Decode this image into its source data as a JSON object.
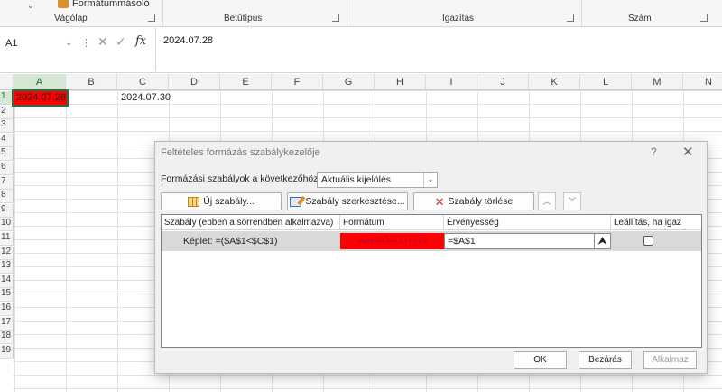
{
  "ribbon": {
    "clipboard_item": "Formátummásoló",
    "groups": [
      "Vágólap",
      "Betűtípus",
      "Igazítás",
      "Szám"
    ]
  },
  "formula_bar": {
    "name_box": "A1",
    "fx": "fx",
    "content": "2024.07.28"
  },
  "grid": {
    "columns": [
      "A",
      "B",
      "C",
      "D",
      "E",
      "F",
      "G",
      "H",
      "I",
      "J",
      "K",
      "L",
      "M",
      "N"
    ],
    "rows": [
      "1",
      "2",
      "3",
      "4",
      "5",
      "6",
      "7",
      "8",
      "9",
      "10",
      "11",
      "12",
      "13",
      "14",
      "15",
      "16",
      "17",
      "18",
      "19"
    ],
    "cells": {
      "A1": "2024.07.28",
      "C1": "2024.07.30"
    },
    "a1_fill": "#ff0000"
  },
  "dialog": {
    "title": "Feltételes formázás szabálykezelője",
    "help": "?",
    "close": "✕",
    "scope_label": "Formázási szabályok a következőhöz:",
    "scope_value": "Aktuális kijelölés",
    "buttons": {
      "new": "Új szabály...",
      "edit": "Szabály szerkesztése...",
      "delete": "Szabály törlése"
    },
    "table_headers": {
      "rule": "Szabály (ebben a sorrendben alkalmazva)",
      "format": "Formátum",
      "applies": "Érvényesség",
      "stop": "Leállítás, ha igaz"
    },
    "rule": {
      "text": "Képlet: =($A$1<$C$1)",
      "preview": "AaBbÕõÜüYyZz",
      "applies_to": "=$A$1",
      "stop_if_true": false
    },
    "footer": {
      "ok": "OK",
      "close": "Bezárás",
      "apply": "Alkalmaz"
    }
  }
}
